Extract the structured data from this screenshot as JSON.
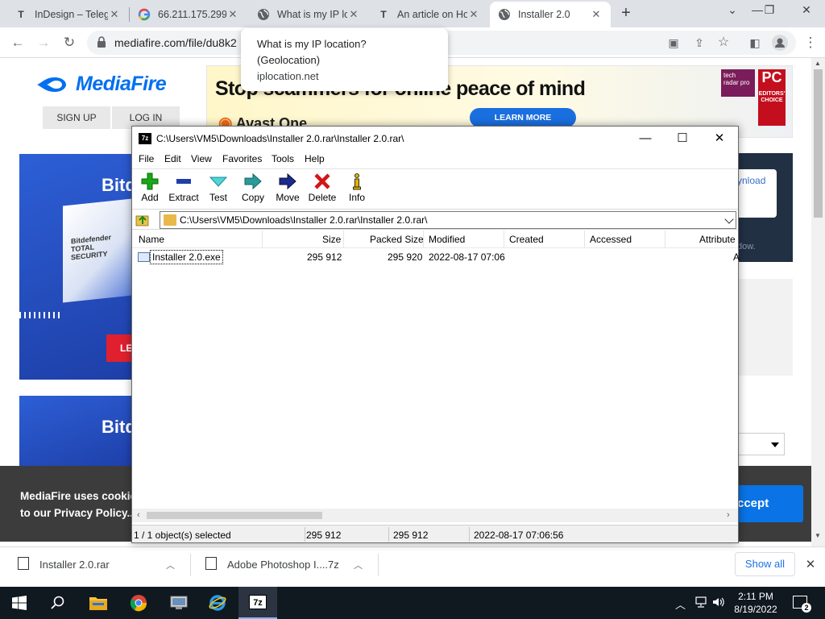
{
  "browser": {
    "tabs": [
      {
        "title": "InDesign – Telegr",
        "favicon": "T"
      },
      {
        "title": "66.211.175.299",
        "favicon": "G"
      },
      {
        "title": "What is my IP lo",
        "favicon": "globe"
      },
      {
        "title": "An article on Ho",
        "favicon": "T"
      },
      {
        "title": "Installer 2.0",
        "favicon": "globe"
      }
    ],
    "url": "mediafire.com/file/du8k2",
    "tooltip": {
      "title": "What is my IP location?",
      "subtitle": "(Geolocation)",
      "host": "iplocation.net"
    }
  },
  "mediafire": {
    "logo": "MediaFire",
    "signup": "SIGN UP",
    "login": "LOG IN",
    "ad": {
      "headline": "Stop scammers for online peace of mind",
      "brand": "Avast One",
      "cta": "LEARN MORE",
      "badge_pc": "PC",
      "badge_pc_sub": "EDITORS' CHOICE",
      "badge_tr": "tech radar pro"
    },
    "side_ad": {
      "title": "Bitd",
      "box_text": "Bitdefender TOTAL SECURITY",
      "cta": "LE"
    },
    "download_partial": "ynload",
    "download_sub": "dow.",
    "cookie_text": "MediaFire uses cookies to our Privacy Policy.",
    "cookie_line1": "MediaFire uses cookies",
    "cookie_line2": "to our Privacy Policy..",
    "accept": "ccept"
  },
  "sevenzip": {
    "title": "C:\\Users\\VM5\\Downloads\\Installer 2.0.rar\\Installer 2.0.rar\\",
    "menu": [
      "File",
      "Edit",
      "View",
      "Favorites",
      "Tools",
      "Help"
    ],
    "tools": [
      "Add",
      "Extract",
      "Test",
      "Copy",
      "Move",
      "Delete",
      "Info"
    ],
    "address": "C:\\Users\\VM5\\Downloads\\Installer 2.0.rar\\Installer 2.0.rar\\",
    "columns": [
      "Name",
      "Size",
      "Packed Size",
      "Modified",
      "Created",
      "Accessed",
      "Attribute"
    ],
    "rows": [
      {
        "name": "Installer 2.0.exe",
        "size": "295 912",
        "packed": "295 920",
        "modified": "2022-08-17 07:06",
        "created": "",
        "accessed": "",
        "attr": "A"
      }
    ],
    "status": {
      "selected": "1 / 1 object(s) selected",
      "size": "295 912",
      "packed": "295 912",
      "modified": "2022-08-17 07:06:56"
    }
  },
  "downloads": {
    "items": [
      {
        "name": "Installer 2.0.rar"
      },
      {
        "name": "Adobe Photoshop I....7z"
      }
    ],
    "show_all": "Show all"
  },
  "taskbar": {
    "time": "2:11 PM",
    "date": "8/19/2022",
    "notifications": "2"
  }
}
